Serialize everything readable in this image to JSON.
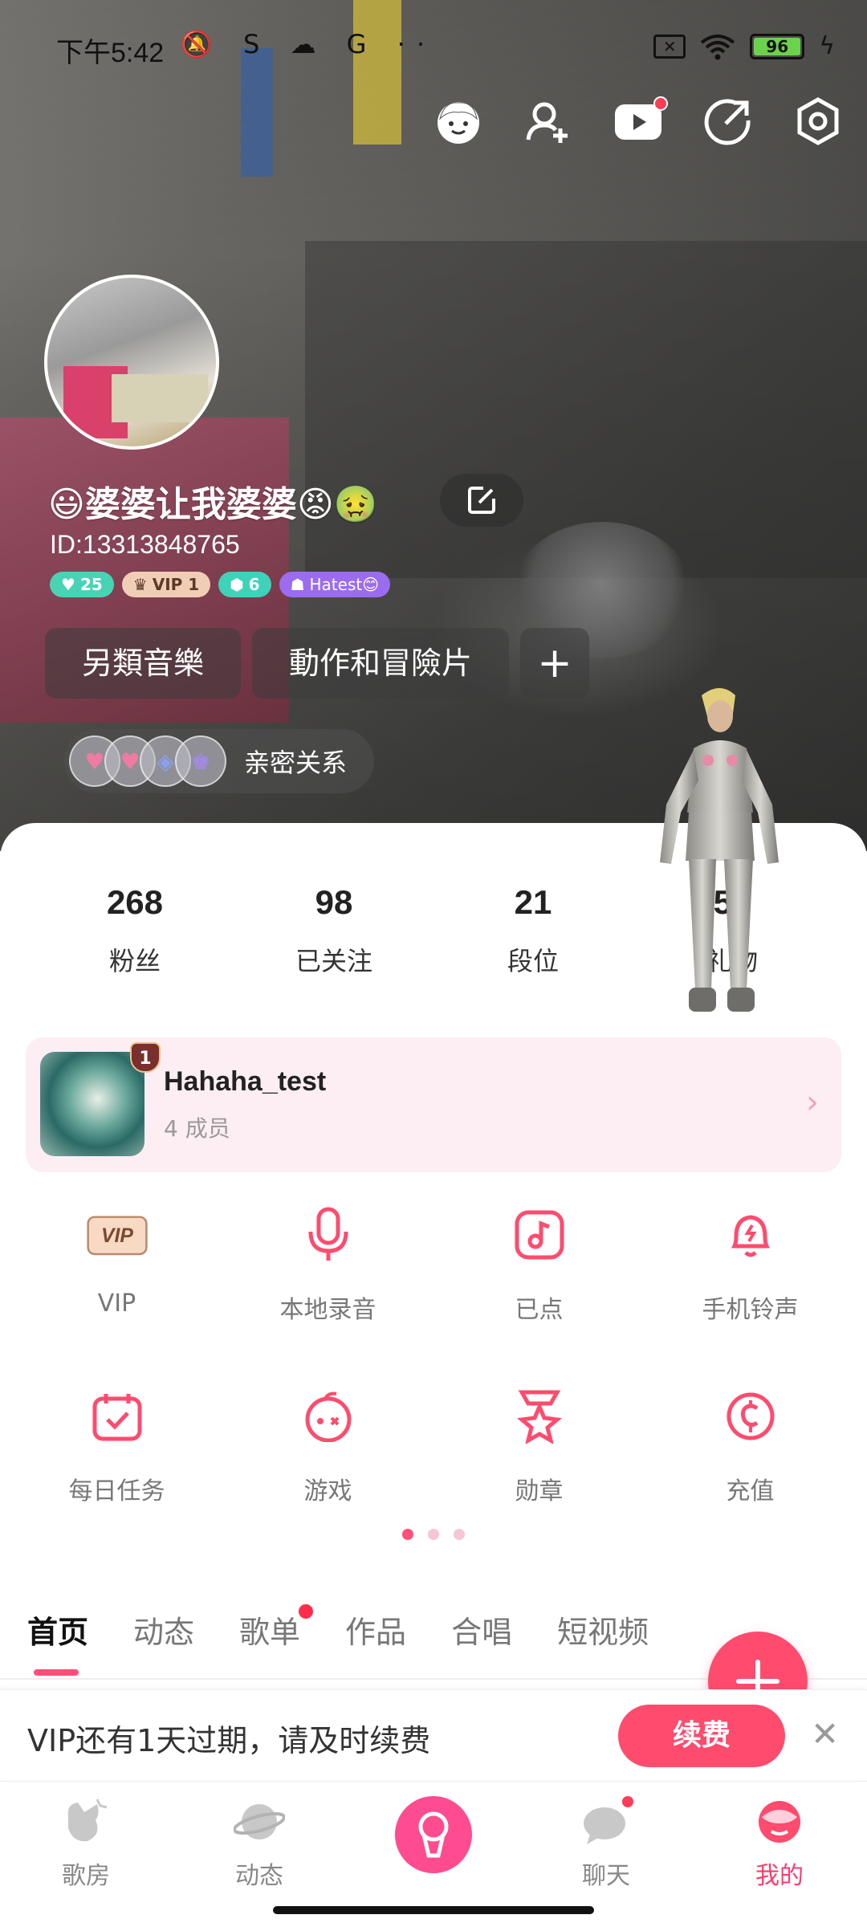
{
  "status_bar": {
    "time": "下午5:42",
    "left_icons": "🔕 S ☁ G ··",
    "battery": "96"
  },
  "profile": {
    "nickname": "😃婆婆让我婆婆😡🤢",
    "id": "ID:13313848765",
    "badges": [
      "25",
      "VIP 1",
      "6",
      "Hatest😊"
    ],
    "tags": [
      "另類音樂",
      "動作和冒險片"
    ],
    "add_tag": "+",
    "intimate_label": "亲密关系"
  },
  "stats": [
    {
      "value": "268",
      "label": "粉丝"
    },
    {
      "value": "98",
      "label": "已关注"
    },
    {
      "value": "21",
      "label": "段位"
    },
    {
      "value": "52",
      "label": "礼物"
    }
  ],
  "family": {
    "level": "1",
    "name": "Hahaha_test",
    "members": "4 成员"
  },
  "features": [
    {
      "label": "VIP",
      "icon": "vip-icon"
    },
    {
      "label": "本地录音",
      "icon": "microphone-icon"
    },
    {
      "label": "已点",
      "icon": "music-note-icon"
    },
    {
      "label": "手机铃声",
      "icon": "bell-icon"
    },
    {
      "label": "每日任务",
      "icon": "calendar-check-icon"
    },
    {
      "label": "游戏",
      "icon": "game-icon"
    },
    {
      "label": "勋章",
      "icon": "medal-icon"
    },
    {
      "label": "充值",
      "icon": "coin-icon"
    }
  ],
  "tabs": [
    "首页",
    "动态",
    "歌单",
    "作品",
    "合唱",
    "短视频"
  ],
  "vip_notice": {
    "message": "VIP还有1天过期，请及时续费",
    "renew": "续费",
    "close": "✕"
  },
  "nav": [
    "歌房",
    "动态",
    "聊天",
    "我的"
  ],
  "colors": {
    "accent": "#ff4b6e",
    "active_nav": "#ff3b6b",
    "family_bg": "#fdeef3"
  }
}
